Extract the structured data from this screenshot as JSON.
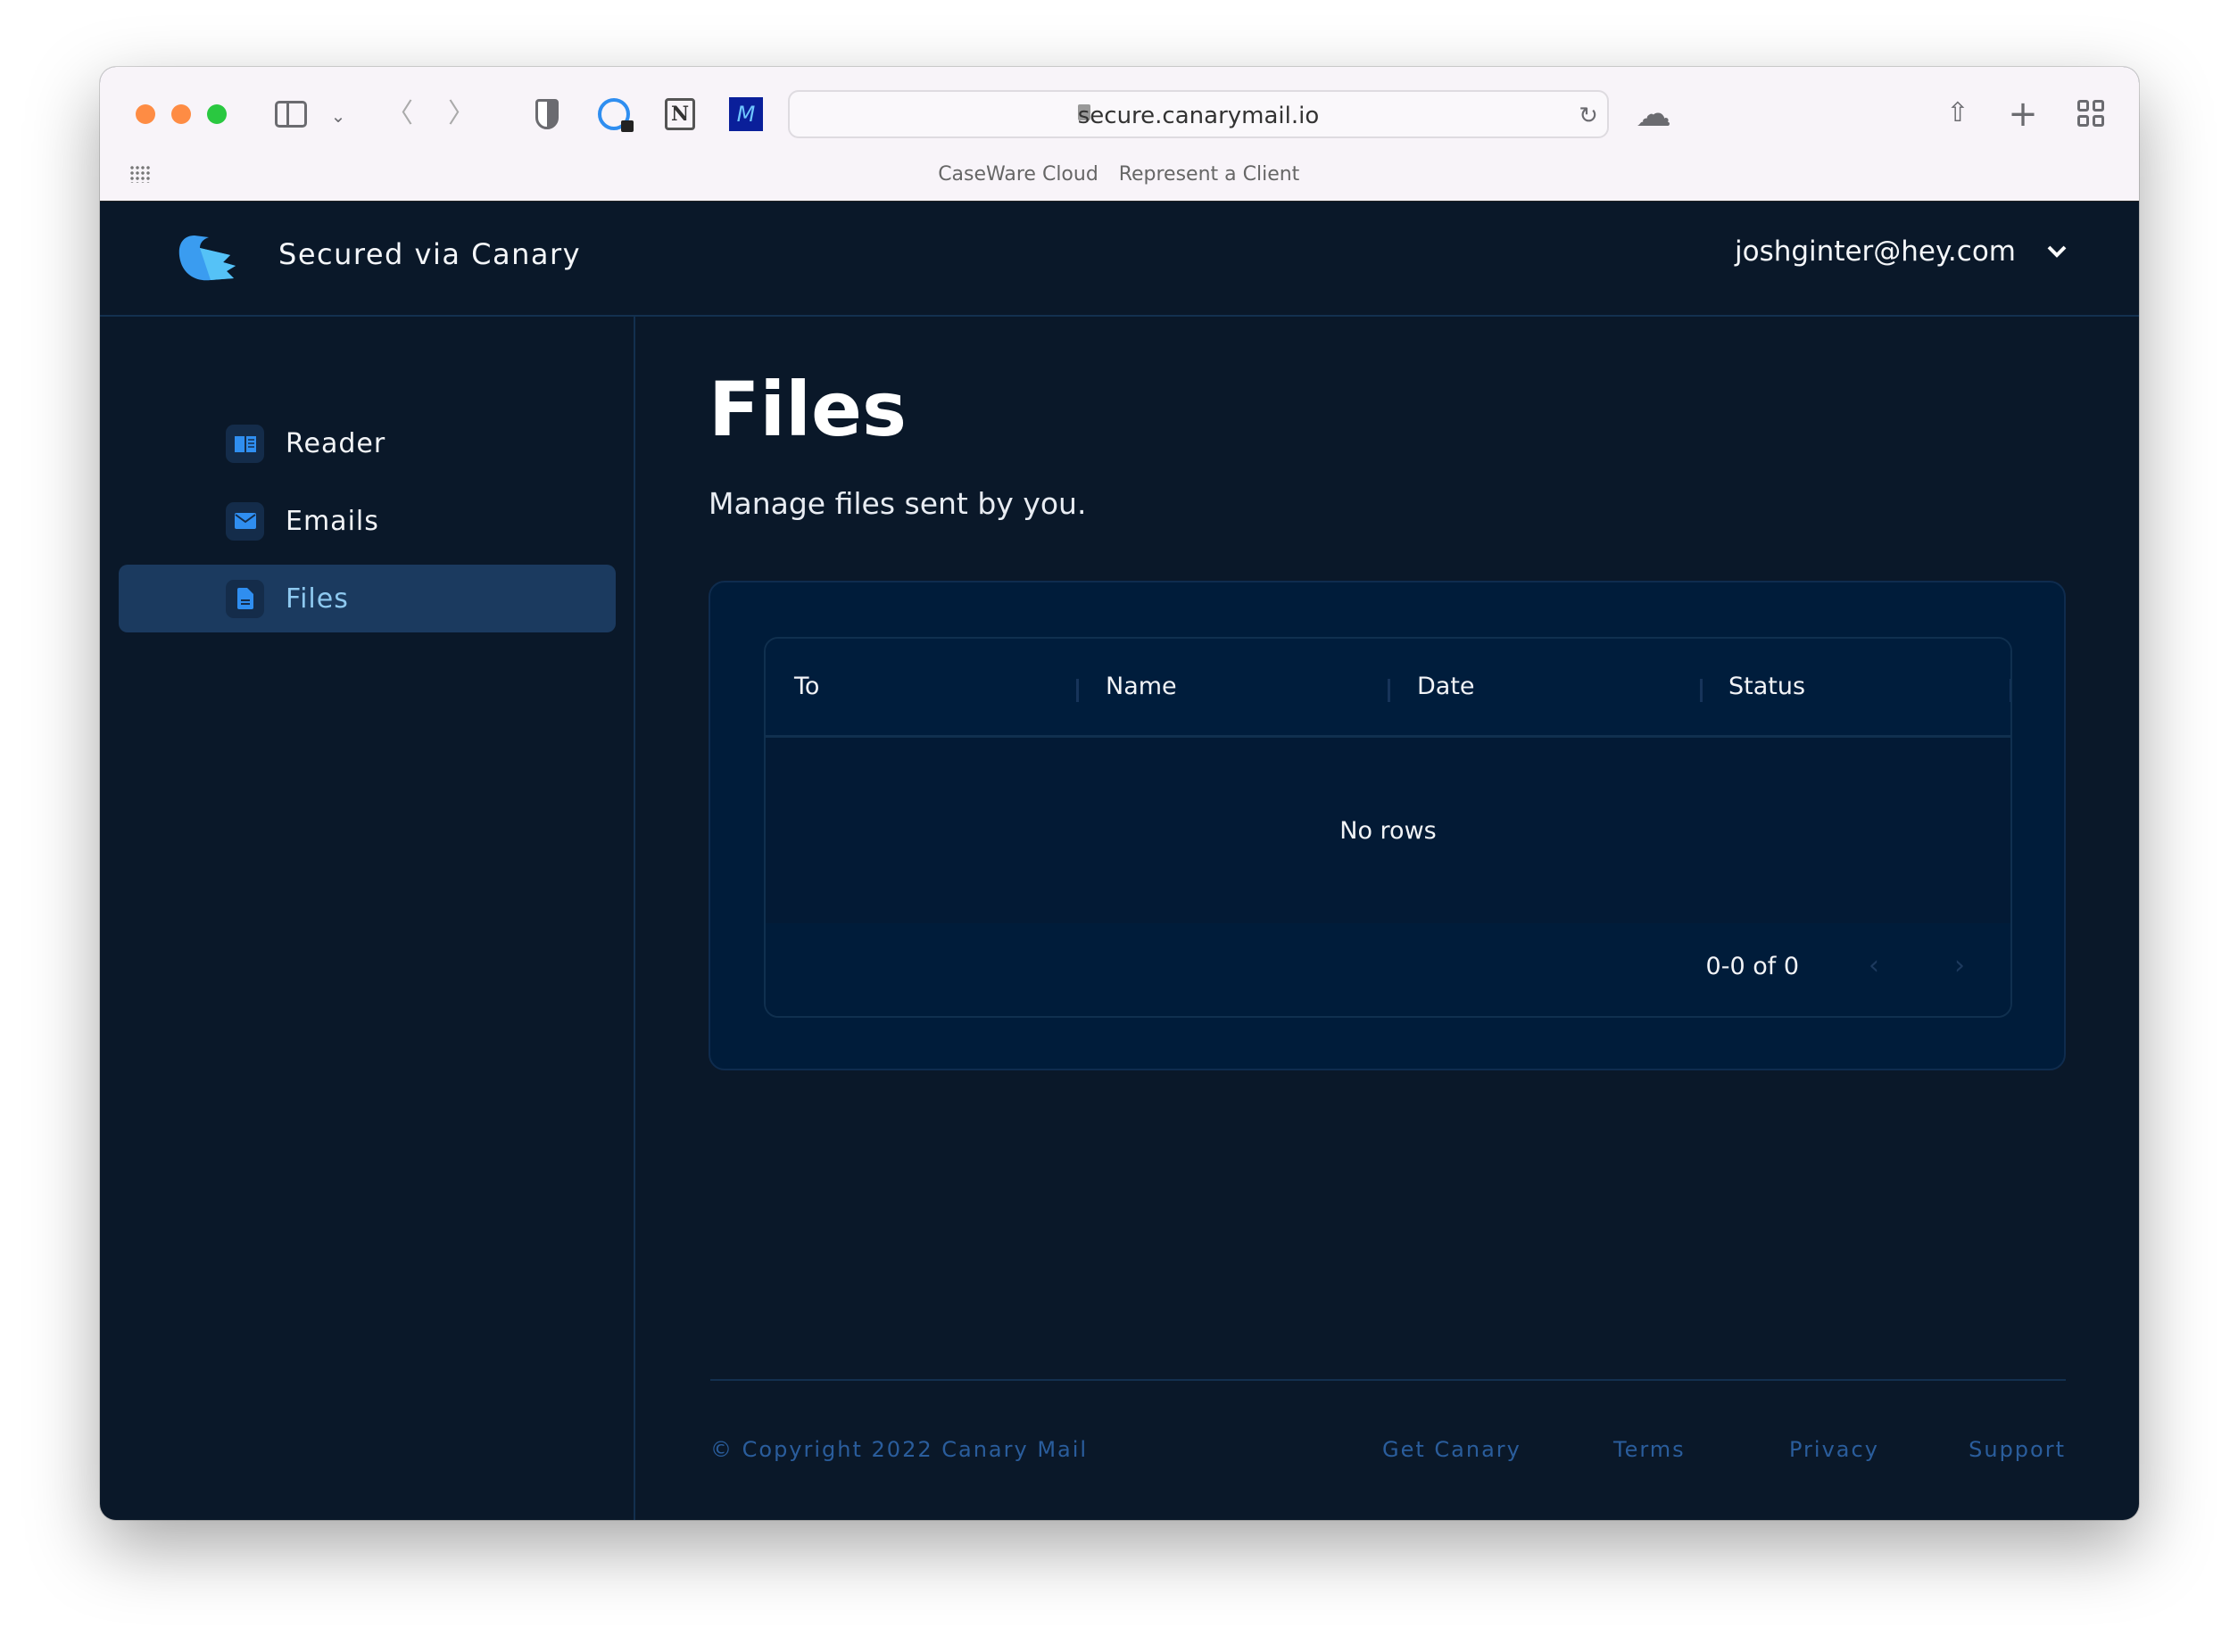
{
  "browser": {
    "url": "secure.canarymail.io",
    "bookmarks": [
      "CaseWare Cloud",
      "Represent a Client"
    ],
    "traffic_colors": [
      "#fe8c44",
      "#fe8c44",
      "#2ac840"
    ],
    "extension_icons": [
      "shield-icon",
      "1password-icon",
      "notion-icon",
      "m-extension-icon"
    ]
  },
  "header": {
    "title": "Secured via Canary",
    "account": "joshginter@hey.com"
  },
  "sidebar": {
    "items": [
      {
        "label": "Reader",
        "icon": "book-icon",
        "active": false
      },
      {
        "label": "Emails",
        "icon": "envelope-icon",
        "active": false
      },
      {
        "label": "Files",
        "icon": "document-icon",
        "active": true
      }
    ]
  },
  "main": {
    "title": "Files",
    "subtitle": "Manage files sent by you.",
    "table": {
      "columns": [
        "To",
        "Name",
        "Date",
        "Status"
      ],
      "empty_text": "No rows",
      "pagination": "0-0 of 0"
    }
  },
  "footer": {
    "copyright": "© Copyright 2022 Canary Mail",
    "links": [
      "Get Canary",
      "Terms",
      "Privacy",
      "Support"
    ]
  },
  "colors": {
    "accent": "#2f8ef0",
    "background": "#0a1829",
    "active_item": "#1b3a5f",
    "footer_link": "#2a5d9c"
  }
}
